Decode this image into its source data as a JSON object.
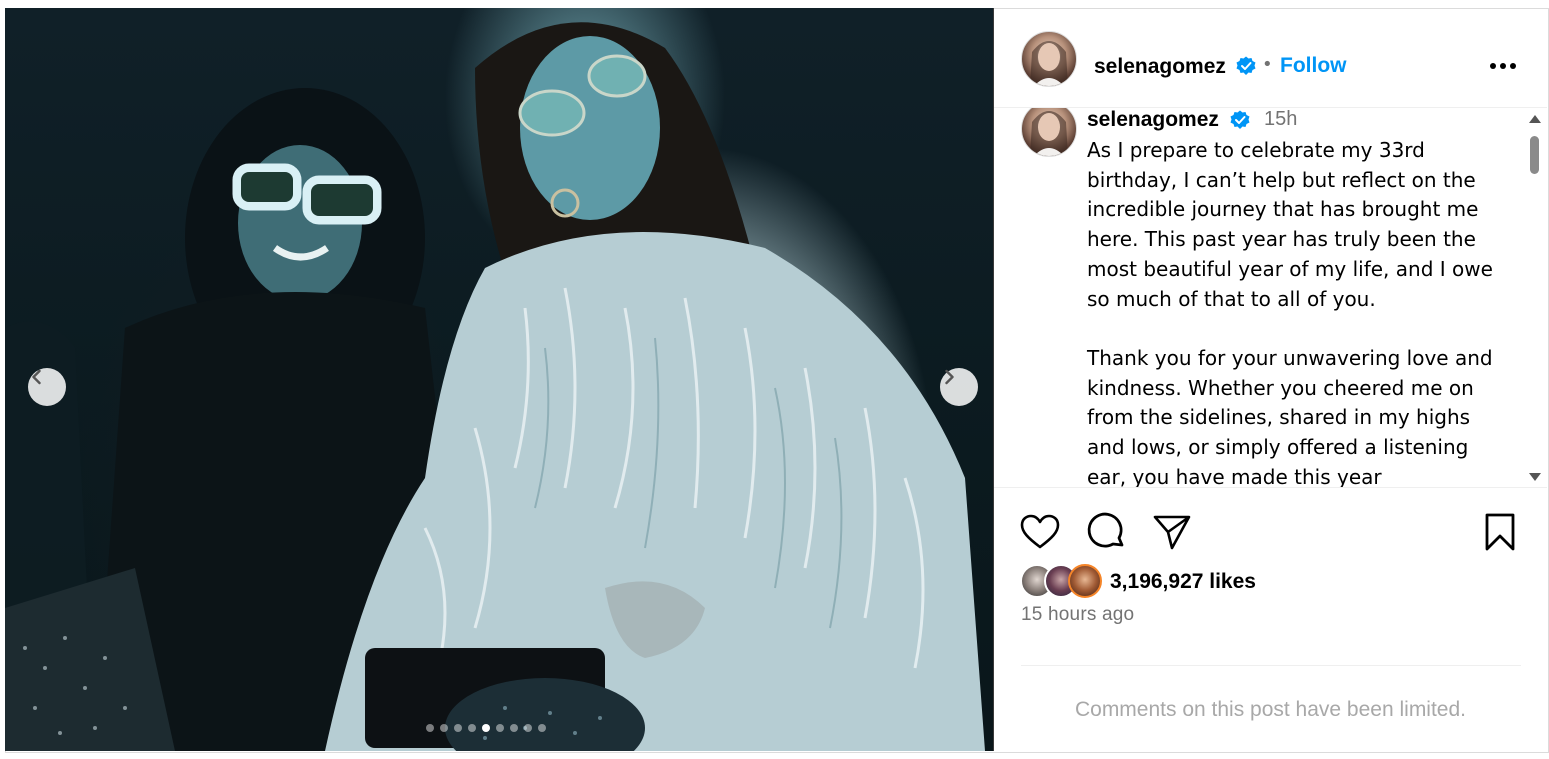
{
  "post": {
    "username": "selenagomez",
    "verified": true,
    "bullet": "•",
    "follow_label": "Follow",
    "more_icon": "more-options-icon",
    "time_ago_short": "15h",
    "caption": "As I prepare to celebrate my 33rd birthday, I can’t help but reflect on the incredible journey that has brought me here. This past year has truly been the most beautiful year of my life, and I owe so much of that to all of you.\n\nThank you for your unwavering love and kindness. Whether you cheered me on from the sidelines, shared in my highs and lows, or simply offered a listening ear, you have made this year",
    "likes_text": "3,196,927 likes",
    "posted_text": "15 hours ago",
    "comments_limited": "Comments on this post have been limited."
  },
  "carousel": {
    "total_slides": 9,
    "active_slide": 5,
    "prev_icon": "chevron-left-icon",
    "next_icon": "chevron-right-icon"
  },
  "actions": {
    "like_icon": "heart-icon",
    "comment_icon": "comment-icon",
    "share_icon": "paper-plane-icon",
    "save_icon": "bookmark-icon"
  },
  "colors": {
    "accent": "#0095f6",
    "verified": "#0095f6",
    "muted": "#737373",
    "limited_text": "#a8a8a8"
  }
}
